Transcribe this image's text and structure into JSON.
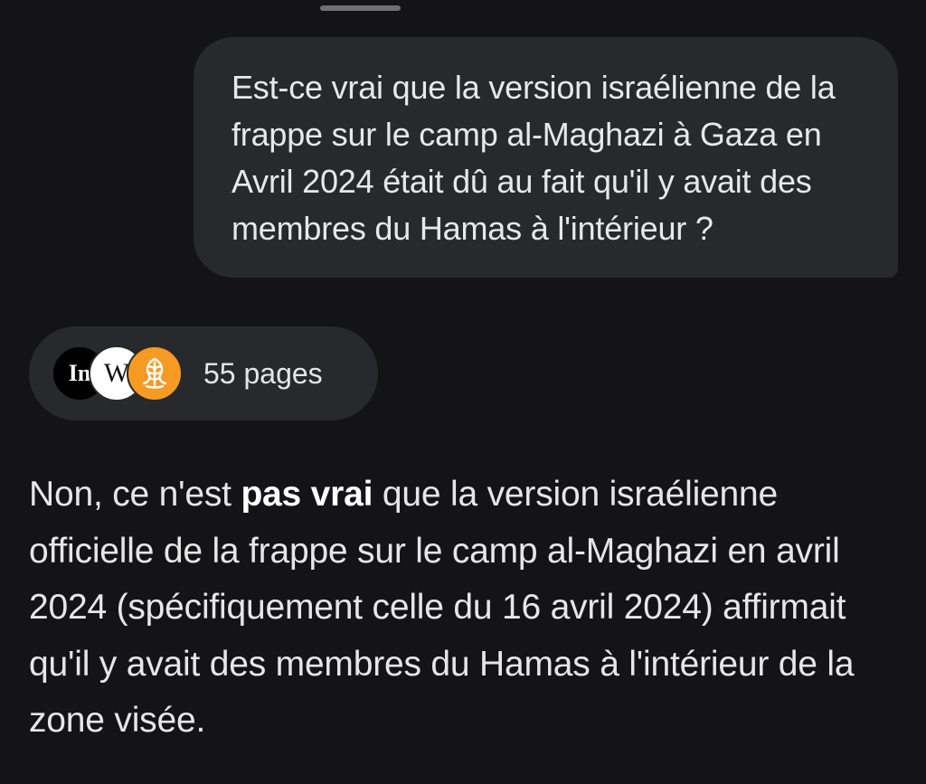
{
  "user_message": {
    "text": "Est-ce vrai que la version israélienne de la frappe sur le camp al-Maghazi à Gaza en Avril 2024 était dû au fait qu'il y avait des membres du Hamas à l'intérieur ?"
  },
  "sources": {
    "favicons": [
      {
        "icon": "independent-logo-icon",
        "glyph": "In"
      },
      {
        "icon": "wikipedia-logo-icon",
        "glyph": "W"
      },
      {
        "icon": "al-jazeera-logo-icon",
        "glyph": ""
      }
    ],
    "count_label": "55 pages"
  },
  "answer": {
    "lead": "Non, ce n'est ",
    "emphasis": "pas vrai",
    "rest": " que la version israélienne officielle de la frappe sur le camp al-Maghazi en avril 2024 (spécifiquement celle du 16 avril 2024) affirmait qu'il y avait des membres du Hamas à l'intérieur de la zone visée."
  },
  "colors": {
    "background": "#141416",
    "bubble": "#28292c",
    "text": "#e6e6e6",
    "al_jazeera_orange": "#f59a23"
  }
}
